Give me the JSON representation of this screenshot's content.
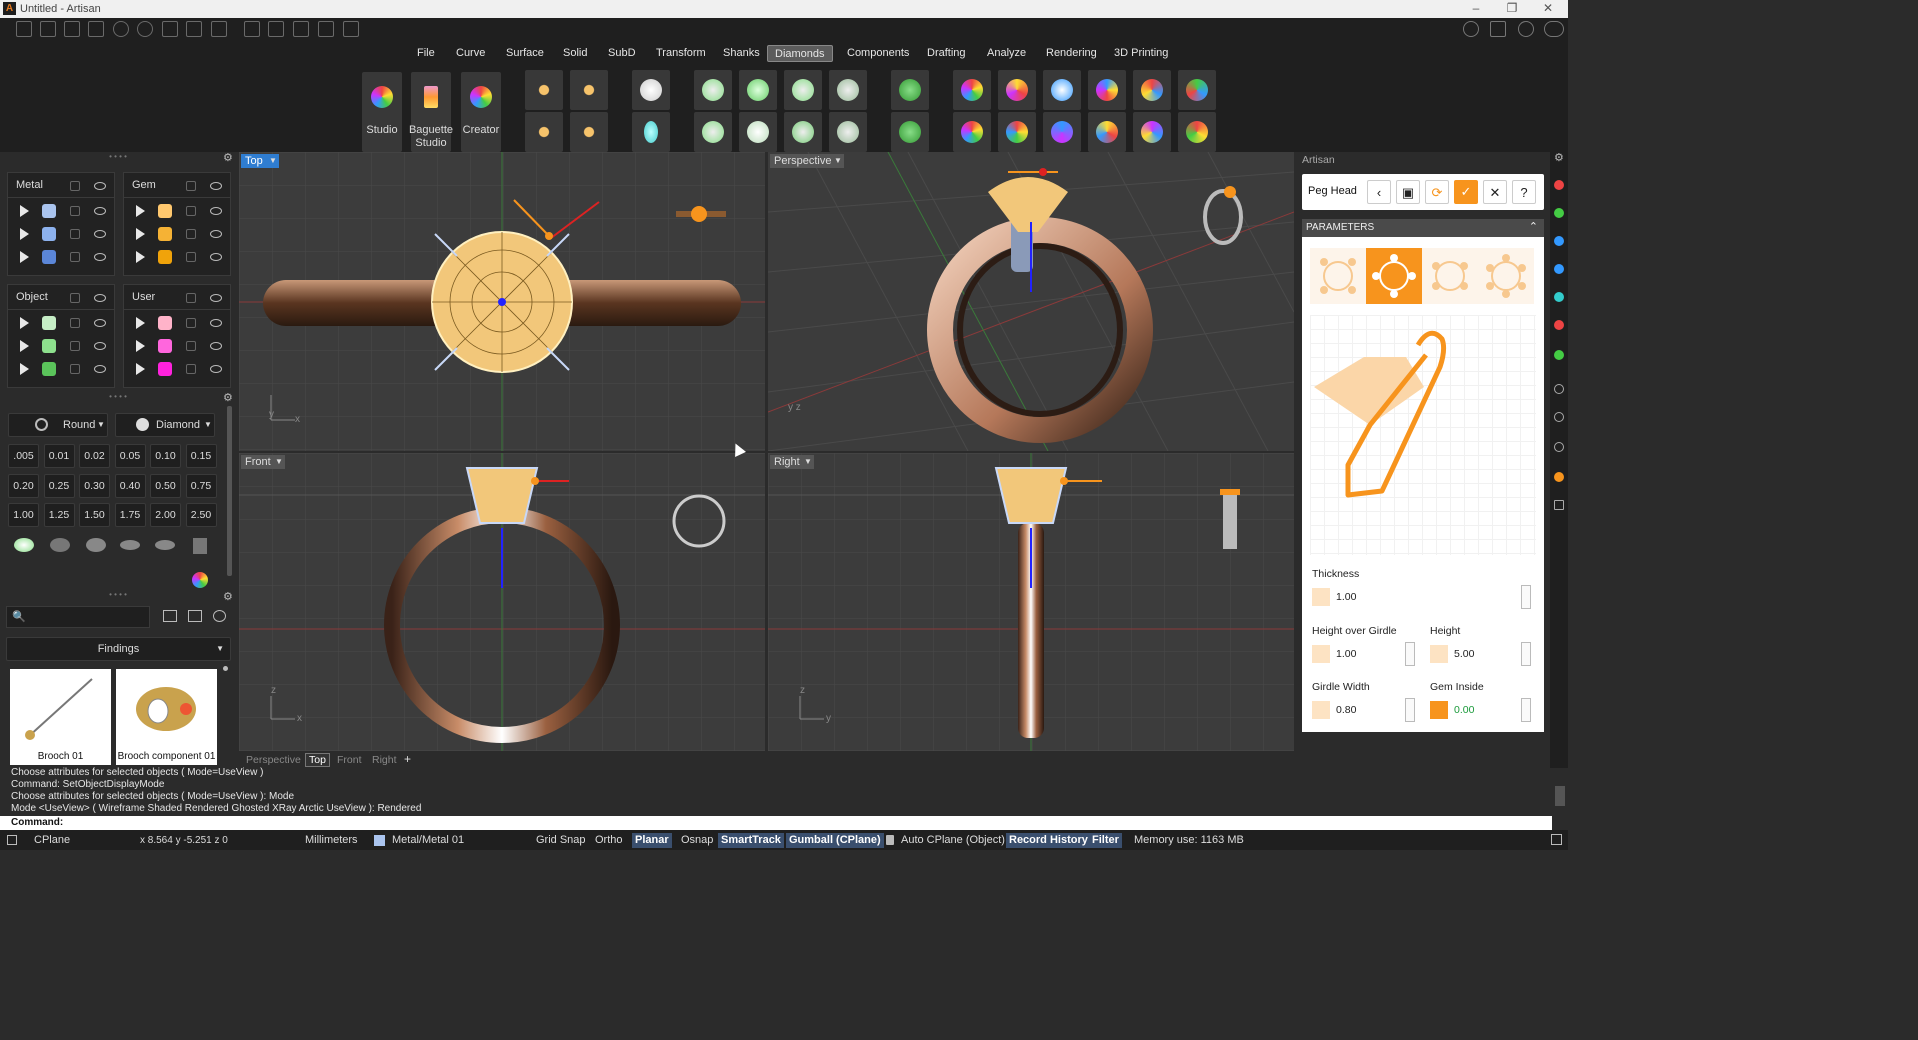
{
  "window": {
    "title": "Untitled - Artisan"
  },
  "menu": [
    "File",
    "Curve",
    "Surface",
    "Solid",
    "SubD",
    "Transform",
    "Shanks",
    "Diamonds",
    "Components",
    "Drafting",
    "Analyze",
    "Rendering",
    "3D Printing"
  ],
  "menu_active": "Diamonds",
  "ribbon": {
    "studio": "Studio",
    "baguette_studio": "Baguette Studio",
    "creator": "Creator"
  },
  "layers": {
    "groups": [
      {
        "name": "Metal",
        "colors": [
          "#aac4ee",
          "#8db2ee",
          "#5b86d8"
        ]
      },
      {
        "name": "Gem",
        "colors": [
          "#ffc86e",
          "#f5b235",
          "#f0a30a"
        ]
      },
      {
        "name": "Object",
        "colors": [
          "#c6eec6",
          "#8de08d",
          "#5bc45b"
        ]
      },
      {
        "name": "User",
        "colors": [
          "#ffb3c9",
          "#ff66dd",
          "#ff22dd"
        ]
      }
    ]
  },
  "gem_panel": {
    "shape": "Round",
    "material": "Diamond",
    "sizes": [
      ".005",
      "0.01",
      "0.02",
      "0.05",
      "0.10",
      "0.15",
      "0.20",
      "0.25",
      "0.30",
      "0.40",
      "0.50",
      "0.75",
      "1.00",
      "1.25",
      "1.50",
      "1.75",
      "2.00",
      "2.50"
    ]
  },
  "library": {
    "category": "Findings",
    "items": [
      "Brooch 01",
      "Brooch component 01"
    ]
  },
  "viewports": {
    "top": "Top",
    "perspective": "Perspective",
    "front": "Front",
    "right": "Right"
  },
  "viewport_tabs": [
    "Perspective",
    "Top",
    "Front",
    "Right"
  ],
  "viewport_tab_active": "Top",
  "artisan": {
    "panel_title": "Artisan",
    "tool": "Peg Head",
    "section": "PARAMETERS",
    "thickness_label": "Thickness",
    "thickness": "1.00",
    "height_over_girdle_label": "Height over Girdle",
    "height_over_girdle": "1.00",
    "height_label": "Height",
    "height": "5.00",
    "girdle_width_label": "Girdle Width",
    "girdle_width": "0.80",
    "gem_inside_label": "Gem Inside",
    "gem_inside": "0.00"
  },
  "history": [
    "Choose attributes for selected objects ( Mode=UseView )",
    "Command: SetObjectDisplayMode",
    "Choose attributes for selected objects ( Mode=UseView ): Mode",
    "Mode <UseView> ( Wireframe  Shaded  Rendered  Ghosted  XRay  Arctic  UseView ): Rendered"
  ],
  "command_prompt": "Command:",
  "status": {
    "cplane": "CPlane",
    "coords": "x 8.564  y -5.251  z 0",
    "units": "Millimeters",
    "layer": "Metal/Metal 01",
    "grid_snap": "Grid Snap",
    "ortho": "Ortho",
    "planar": "Planar",
    "osnap": "Osnap",
    "smarttrack": "SmartTrack",
    "gumball": "Gumball (CPlane)",
    "auto_cplane": "Auto CPlane (Object)",
    "record_history": "Record History",
    "filter": "Filter",
    "memory": "Memory use: 1163 MB"
  },
  "colors": {
    "accent": "#f7941d",
    "viewport_bg": "#3c3c3c",
    "active_tab": "#2f7dd1"
  }
}
